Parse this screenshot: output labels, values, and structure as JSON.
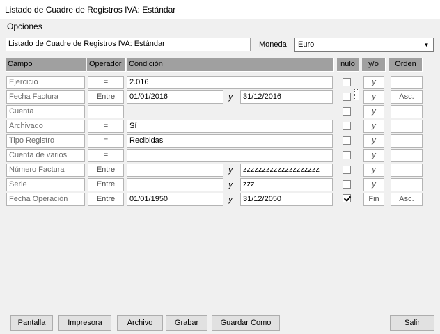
{
  "window": {
    "title": "Listado de Cuadre de Registros IVA: Estándar"
  },
  "menu": {
    "items": [
      {
        "label": "Opciones"
      }
    ]
  },
  "report": {
    "title_value": "Listado de Cuadre de Registros IVA: Estándar",
    "currency_label": "Moneda",
    "currency_value": "Euro"
  },
  "grid": {
    "headers": {
      "campo": "Campo",
      "operador": "Operador",
      "condicion": "Condición",
      "nulo": "nulo",
      "yo": "y/o",
      "orden": "Orden"
    },
    "connector": "y",
    "rows": [
      {
        "campo": "Ejercicio",
        "operador": "=",
        "cond1": "2.016",
        "cond2": "",
        "nulo": false,
        "yo": "y",
        "orden": ""
      },
      {
        "campo": "Fecha Factura",
        "operador": "Entre",
        "cond1": "01/01/2016",
        "cond2": "31/12/2016",
        "nulo": false,
        "yo": "y",
        "orden": "Asc."
      },
      {
        "campo": "Cuenta",
        "operador": "",
        "cond1": "",
        "cond2": "",
        "nulo": false,
        "yo": "y",
        "orden": ""
      },
      {
        "campo": "Archivado",
        "operador": "=",
        "cond1": "Sí",
        "cond2": "",
        "nulo": false,
        "yo": "y",
        "orden": ""
      },
      {
        "campo": "Tipo Registro",
        "operador": "=",
        "cond1": "Recibidas",
        "cond2": "",
        "nulo": false,
        "yo": "y",
        "orden": ""
      },
      {
        "campo": "Cuenta de varios",
        "operador": "=",
        "cond1": "",
        "cond2": "",
        "nulo": false,
        "yo": "y",
        "orden": ""
      },
      {
        "campo": "Número Factura",
        "operador": "Entre",
        "cond1": "",
        "cond2": "zzzzzzzzzzzzzzzzzzzz",
        "nulo": false,
        "yo": "y",
        "orden": ""
      },
      {
        "campo": "Serie",
        "operador": "Entre",
        "cond1": "",
        "cond2": "zzz",
        "nulo": false,
        "yo": "y",
        "orden": ""
      },
      {
        "campo": "Fecha Operación",
        "operador": "Entre",
        "cond1": "01/01/1950",
        "cond2": "31/12/2050",
        "nulo": true,
        "yo": "Fin",
        "orden": "Asc."
      }
    ]
  },
  "buttons": {
    "pantalla": {
      "mnemonic": "P",
      "rest": "antalla"
    },
    "impresora": {
      "mnemonic": "I",
      "rest": "mpresora"
    },
    "archivo": {
      "mnemonic": "A",
      "rest": "rchivo"
    },
    "grabar": {
      "mnemonic": "G",
      "rest": "rabar"
    },
    "guardar_como": {
      "pre": "Guardar ",
      "mnemonic": "C",
      "rest": "omo"
    },
    "salir": {
      "mnemonic": "S",
      "rest": "alir"
    }
  }
}
